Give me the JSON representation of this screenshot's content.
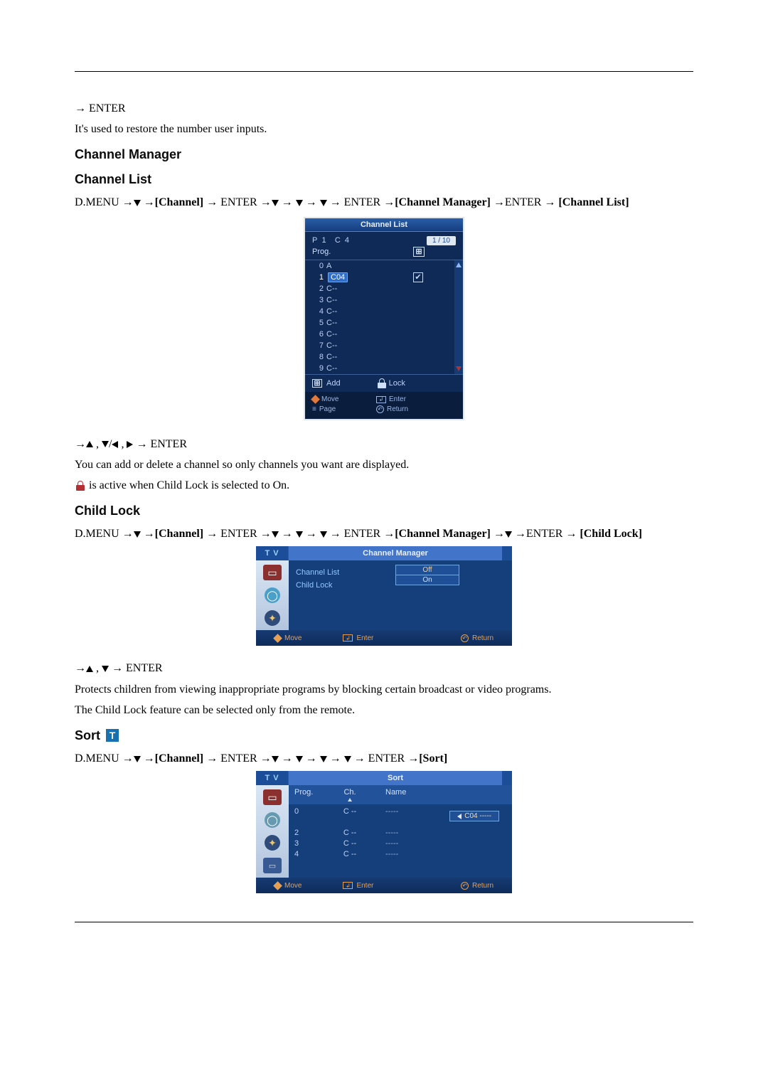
{
  "intro": {
    "line1_after_arrow": "ENTER",
    "body": "It's used to restore the number user inputs."
  },
  "section_cm_heading": "Channel Manager",
  "section_cl_heading": "Channel List",
  "cl_nav": {
    "dmenu": "D.MENU",
    "channel": "[Channel]",
    "enter": "ENTER",
    "cmgr": "[Channel Manager]",
    "enter2": "ENTER",
    "cl": "[Channel List]"
  },
  "cl_panel": {
    "title": "Channel List",
    "P": "P",
    "Pnum": "1",
    "C": "C",
    "Cnum": "4",
    "count": "1 / 10",
    "prog_label": "Prog.",
    "rows": [
      {
        "n": "0",
        "name": "A"
      },
      {
        "n": "1",
        "name": "C04"
      },
      {
        "n": "2",
        "name": "C--"
      },
      {
        "n": "3",
        "name": "C--"
      },
      {
        "n": "4",
        "name": "C--"
      },
      {
        "n": "5",
        "name": "C--"
      },
      {
        "n": "6",
        "name": "C--"
      },
      {
        "n": "7",
        "name": "C--"
      },
      {
        "n": "8",
        "name": "C--"
      },
      {
        "n": "9",
        "name": "C--"
      }
    ],
    "add": "Add",
    "lock": "Lock",
    "move": "Move",
    "enter": "Enter",
    "page": "Page",
    "return": "Return"
  },
  "cl_after": {
    "enter": "ENTER",
    "body": "You can add or delete a channel so only channels you want are displayed.",
    "lock_text": "is active when Child Lock is selected to On."
  },
  "section_lock_heading": "Child Lock",
  "lock_nav": {
    "dmenu": "D.MENU",
    "channel": "[Channel]",
    "enter": "ENTER",
    "cmgr": "[Channel Manager]",
    "enter2": "ENTER",
    "cl": "[Child Lock]"
  },
  "cm_panel": {
    "tv": "T V",
    "title": "Channel Manager",
    "item1": "Channel List",
    "item2": "Child Lock",
    "off": "Off",
    "on": "On",
    "move": "Move",
    "enter": "Enter",
    "return": "Return"
  },
  "lock_after": {
    "enter": "ENTER",
    "body1": "Protects children from viewing inappropriate programs by blocking certain broadcast or video programs.",
    "body2": "The Child Lock feature can be selected only from the remote."
  },
  "section_sort_heading": "Sort",
  "sort_nav": {
    "dmenu": "D.MENU",
    "channel": "[Channel]",
    "enter": "ENTER",
    "sort": "[Sort]"
  },
  "sort_panel": {
    "tv": "T V",
    "title": "Sort",
    "h_prog": "Prog.",
    "h_ch": "Ch.",
    "h_name": "Name",
    "badge": "C04 -----",
    "rows": [
      {
        "p": "0",
        "ch": "C --",
        "name": "-----"
      },
      {
        "p": "",
        "ch": "",
        "name": ""
      },
      {
        "p": "2",
        "ch": "C --",
        "name": "-----"
      },
      {
        "p": "3",
        "ch": "C --",
        "name": "-----"
      },
      {
        "p": "4",
        "ch": "C --",
        "name": "-----"
      }
    ],
    "move": "Move",
    "enter": "Enter",
    "return": "Return"
  }
}
